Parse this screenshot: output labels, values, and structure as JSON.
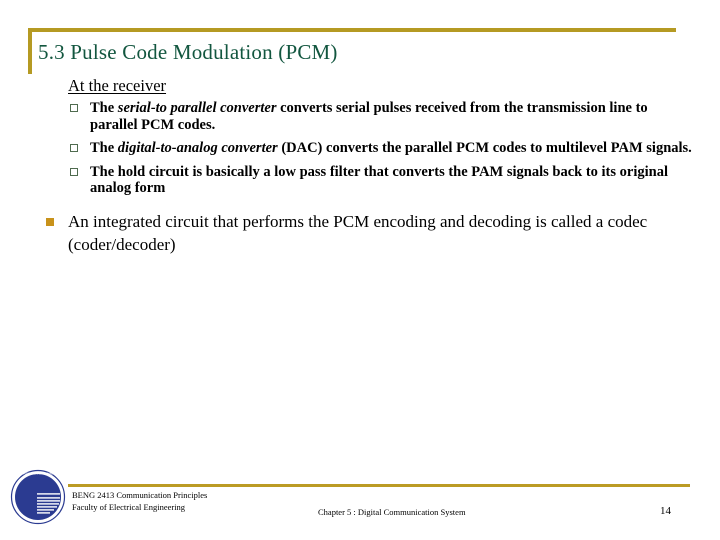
{
  "slide": {
    "title": "5.3 Pulse Code Modulation (PCM)",
    "accent_color": "#b59a23",
    "title_color": "#12563f",
    "background_color": "#ffffff"
  },
  "content": {
    "section_heading": "At the receiver",
    "sub_bullets": [
      {
        "marker": "hollow-square-bullet",
        "parts": [
          {
            "text": "The ",
            "style": "bold"
          },
          {
            "text": "serial-to parallel converter",
            "style": "bold-italic"
          },
          {
            "text": " converts serial pulses received from the transmission line to parallel PCM codes.",
            "style": "bold"
          }
        ]
      },
      {
        "marker": "hollow-square-bullet",
        "parts": [
          {
            "text": "The ",
            "style": "bold"
          },
          {
            "text": "digital-to-analog converter",
            "style": "bold-italic"
          },
          {
            "text": " (DAC) converts the parallel PCM codes to multilevel PAM signals.",
            "style": "bold"
          }
        ]
      },
      {
        "marker": "hollow-square-bullet",
        "parts": [
          {
            "text": "The hold circuit is basically a low pass filter that converts the PAM signals back to its original analog form",
            "style": "bold"
          }
        ]
      }
    ],
    "main_bullets": [
      {
        "marker": "filled-square-bullet",
        "text": "An integrated circuit that performs the PCM encoding and decoding is called a codec (coder/decoder)"
      }
    ]
  },
  "footer": {
    "course_line_1": "BENG 2413 Communication Principles",
    "course_line_2": "Faculty of Electrical Engineering",
    "chapter": "Chapter 5 : Digital Communication System",
    "page_number": "14",
    "logo": "university-seal-logo",
    "logo_color": "#2b3b91",
    "rule_color": "#bb9b24"
  }
}
